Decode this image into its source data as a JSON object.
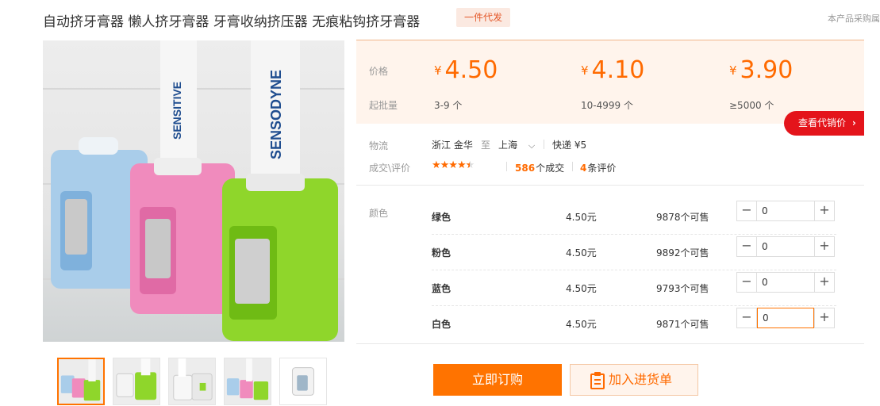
{
  "product": {
    "title": "自动挤牙膏器 懒人挤牙膏器 牙膏收纳挤压器 无痕粘钩挤牙膏器",
    "tag": "一件代发",
    "notice": "本产品采购属"
  },
  "price_box": {
    "price_label": "价格",
    "qty_label": "起批量",
    "currency": "¥",
    "tiers": [
      {
        "price": "4.50",
        "qty": "3-9 个"
      },
      {
        "price": "4.10",
        "qty": "10-4999 个"
      },
      {
        "price": "3.90",
        "qty": "≥5000 个"
      }
    ],
    "agent_button": "查看代销价",
    "accent_color": "#ff6a00"
  },
  "logistics": {
    "label": "物流",
    "from": "浙江 金华",
    "to_word": "至",
    "to": "上海",
    "shipping": "快递 ¥5"
  },
  "reviews": {
    "label": "成交\\评价",
    "rating": 4.5,
    "deals_count": "586",
    "deals_suffix": "个成交",
    "review_count": "4",
    "review_suffix": "条评价"
  },
  "sku": {
    "label": "颜色",
    "items": [
      {
        "name": "绿色",
        "price": "4.50元",
        "stock": "9878个可售",
        "qty": "0"
      },
      {
        "name": "粉色",
        "price": "4.50元",
        "stock": "9892个可售",
        "qty": "0"
      },
      {
        "name": "蓝色",
        "price": "4.50元",
        "stock": "9793个可售",
        "qty": "0"
      },
      {
        "name": "白色",
        "price": "4.50元",
        "stock": "9871个可售",
        "qty": "0"
      }
    ]
  },
  "actions": {
    "buy": "立即订购",
    "cart": "加入进货单"
  },
  "gallery": {
    "thumb_count": 5,
    "active_index": 0
  }
}
